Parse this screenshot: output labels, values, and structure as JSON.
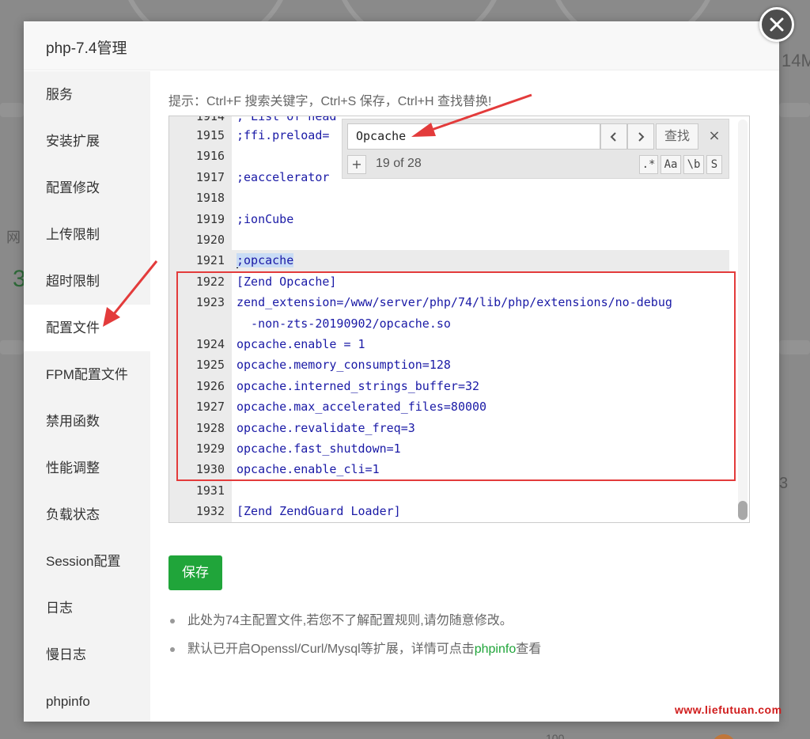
{
  "background": {
    "right_text": "14M",
    "left_text": "网",
    "left_number": "3",
    "right_number": "3",
    "bottom_number": "100"
  },
  "modal": {
    "title": "php-7.4管理",
    "close_icon": "close-icon"
  },
  "sidebar": {
    "items": [
      {
        "label": "服务",
        "active": false
      },
      {
        "label": "安装扩展",
        "active": false
      },
      {
        "label": "配置修改",
        "active": false
      },
      {
        "label": "上传限制",
        "active": false
      },
      {
        "label": "超时限制",
        "active": false
      },
      {
        "label": "配置文件",
        "active": true
      },
      {
        "label": "FPM配置文件",
        "active": false
      },
      {
        "label": "禁用函数",
        "active": false
      },
      {
        "label": "性能调整",
        "active": false
      },
      {
        "label": "负载状态",
        "active": false
      },
      {
        "label": "Session配置",
        "active": false
      },
      {
        "label": "日志",
        "active": false
      },
      {
        "label": "慢日志",
        "active": false
      },
      {
        "label": "phpinfo",
        "active": false
      }
    ]
  },
  "content": {
    "hint": "提示：Ctrl+F 搜索关键字，Ctrl+S 保存，Ctrl+H 查找替换!",
    "editor": {
      "partial_top": "; List of head",
      "lines": [
        {
          "num": "1915",
          "text": ";ffi.preload="
        },
        {
          "num": "1916",
          "text": ""
        },
        {
          "num": "1917",
          "text": ";eaccelerator"
        },
        {
          "num": "1918",
          "text": ""
        },
        {
          "num": "1919",
          "text": ";ionCube"
        },
        {
          "num": "1920",
          "text": ""
        },
        {
          "num": "1921",
          "text": ";opcache"
        },
        {
          "num": "1922",
          "text": "[Zend Opcache]"
        },
        {
          "num": "1923",
          "text": "zend_extension=/www/server/php/74/lib/php/extensions/no-debug"
        },
        {
          "num": "",
          "text": "  -non-zts-20190902/opcache.so"
        },
        {
          "num": "1924",
          "text": "opcache.enable = 1"
        },
        {
          "num": "1925",
          "text": "opcache.memory_consumption=128"
        },
        {
          "num": "1926",
          "text": "opcache.interned_strings_buffer=32"
        },
        {
          "num": "1927",
          "text": "opcache.max_accelerated_files=80000"
        },
        {
          "num": "1928",
          "text": "opcache.revalidate_freq=3"
        },
        {
          "num": "1929",
          "text": "opcache.fast_shutdown=1"
        },
        {
          "num": "1930",
          "text": "opcache.enable_cli=1"
        },
        {
          "num": "1931",
          "text": ""
        },
        {
          "num": "1932",
          "text": "[Zend ZendGuard Loader]"
        }
      ]
    },
    "search": {
      "value": "Opcache",
      "prev": "<",
      "next": ">",
      "find_label": "查找",
      "close": "×",
      "plus": "+",
      "count": "19 of 28",
      "opt_regex": ".*",
      "opt_case": "Aa",
      "opt_word": "\\b",
      "opt_selection": "S"
    },
    "save_label": "保存",
    "notes": {
      "note1": "此处为74主配置文件,若您不了解配置规则,请勿随意修改。",
      "note2_prefix": "默认已开启Openssl/Curl/Mysql等扩展，详情可点击",
      "note2_link": "phpinfo",
      "note2_suffix": "查看"
    }
  },
  "watermark": "www.liefutuan.com",
  "colors": {
    "accent": "#20a53a",
    "annotation": "#e33b3b",
    "code": "#1a1aa6"
  }
}
